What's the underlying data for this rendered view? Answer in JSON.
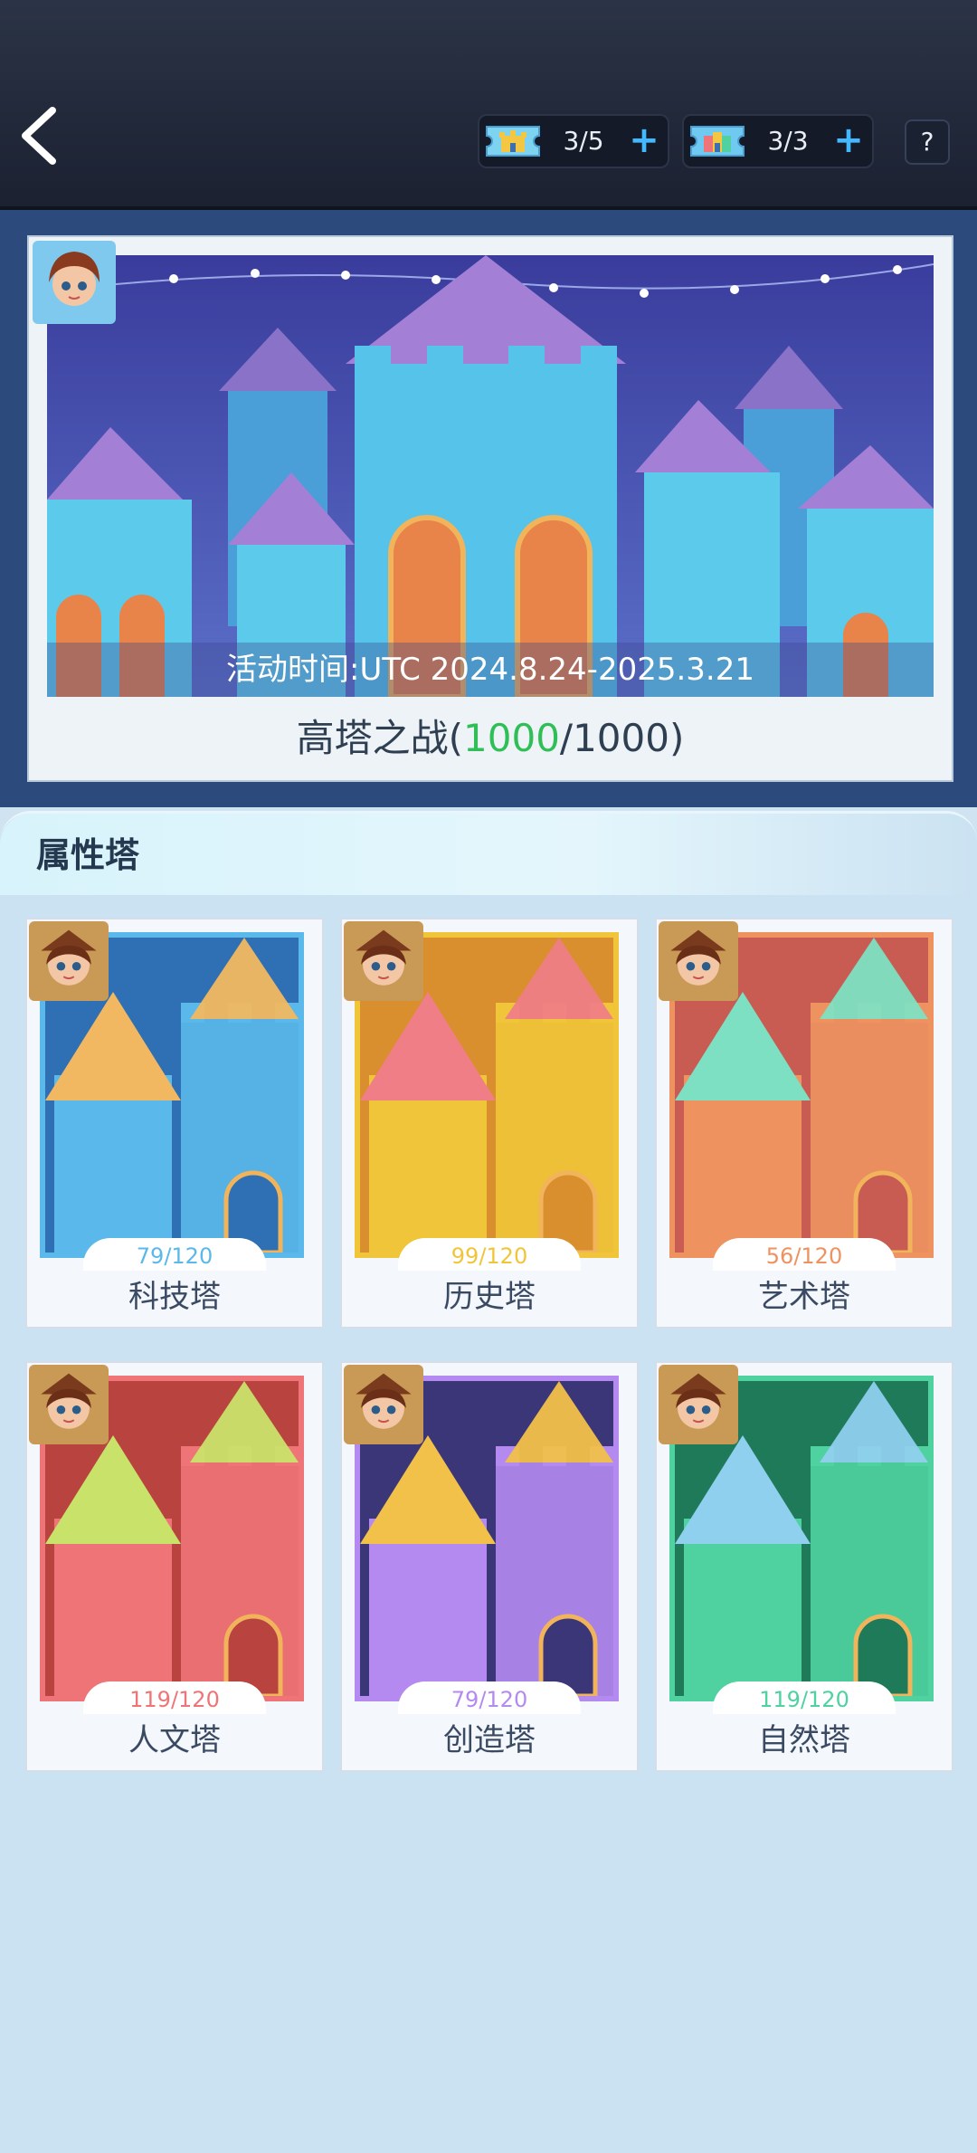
{
  "header": {
    "counters": [
      {
        "value": "3/5",
        "icon": "castle-ticket-icon"
      },
      {
        "value": "3/3",
        "icon": "rainbow-castle-ticket-icon"
      }
    ],
    "help_label": "?"
  },
  "banner": {
    "time_text": "活动时间:UTC 2024.8.24-2025.3.21",
    "title_prefix": "高塔之战(",
    "progress": "1000",
    "title_suffix": "/1000)"
  },
  "section": {
    "title": "属性塔"
  },
  "towers": [
    {
      "name": "科技塔",
      "progress": "79/120",
      "color": "#5bb8ea",
      "bg": "#2f6fb3",
      "accent": "#f2b861"
    },
    {
      "name": "历史塔",
      "progress": "99/120",
      "color": "#f0c53a",
      "bg": "#d98f2e",
      "accent": "#ef7e86"
    },
    {
      "name": "艺术塔",
      "progress": "56/120",
      "color": "#ee9360",
      "bg": "#c85c52",
      "accent": "#7ee0c2"
    },
    {
      "name": "人文塔",
      "progress": "119/120",
      "color": "#ef7478",
      "bg": "#b8433f",
      "accent": "#c9e36a"
    },
    {
      "name": "创造塔",
      "progress": "79/120",
      "color": "#b58af0",
      "bg": "#3a3678",
      "accent": "#f2c14a"
    },
    {
      "name": "自然塔",
      "progress": "119/120",
      "color": "#4fd1a0",
      "bg": "#1f7a5a",
      "accent": "#8fd0ee"
    }
  ]
}
